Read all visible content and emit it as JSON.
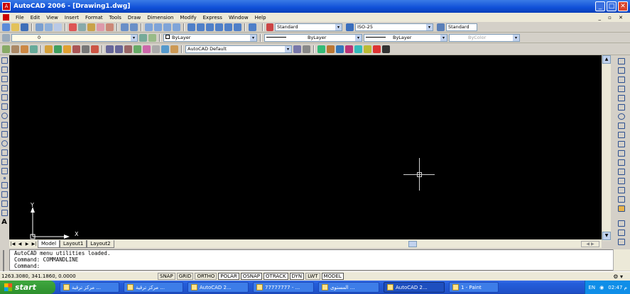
{
  "window": {
    "title": "AutoCAD 2006 - [Drawing1.dwg]"
  },
  "menu": [
    "File",
    "Edit",
    "View",
    "Insert",
    "Format",
    "Tools",
    "Draw",
    "Dimension",
    "Modify",
    "Express",
    "Window",
    "Help"
  ],
  "styles_toolbar": {
    "text_style": "Standard",
    "dim_style": "ISO-25",
    "table_style": "Standard"
  },
  "layers_toolbar": {
    "layer": "0",
    "layer_combo": "ByLayer",
    "linetype": "ByLayer",
    "lineweight": "ByLayer",
    "plotstyle": "ByColor"
  },
  "workspace": {
    "name": "AutoCAD Default"
  },
  "canvas": {
    "ucs_x": "X",
    "ucs_y": "Y"
  },
  "layout_tabs": [
    "Model",
    "Layout1",
    "Layout2"
  ],
  "command_window": {
    "lines": [
      "AutoCAD menu utilities loaded.",
      "Command: COMMANDLINE",
      "Command:"
    ]
  },
  "status": {
    "coords": "1263.3080, 341.1860, 0.0000",
    "toggles": [
      {
        "label": "SNAP",
        "on": false
      },
      {
        "label": "GRID",
        "on": false
      },
      {
        "label": "ORTHO",
        "on": false
      },
      {
        "label": "POLAR",
        "on": true
      },
      {
        "label": "OSNAP",
        "on": true
      },
      {
        "label": "OTRACK",
        "on": true
      },
      {
        "label": "DYN",
        "on": true
      },
      {
        "label": "LWT",
        "on": false
      },
      {
        "label": "MODEL",
        "on": true
      }
    ]
  },
  "taskbar": {
    "start": "start",
    "buttons": [
      "مركز ترقية ...",
      "مركز ترقية ...",
      "AutoCAD 2...",
      "77777777 - ...",
      "المستوى ...",
      "AutoCAD 2...",
      "1 - Paint"
    ],
    "lang": "EN",
    "clock": "02:47 م"
  }
}
